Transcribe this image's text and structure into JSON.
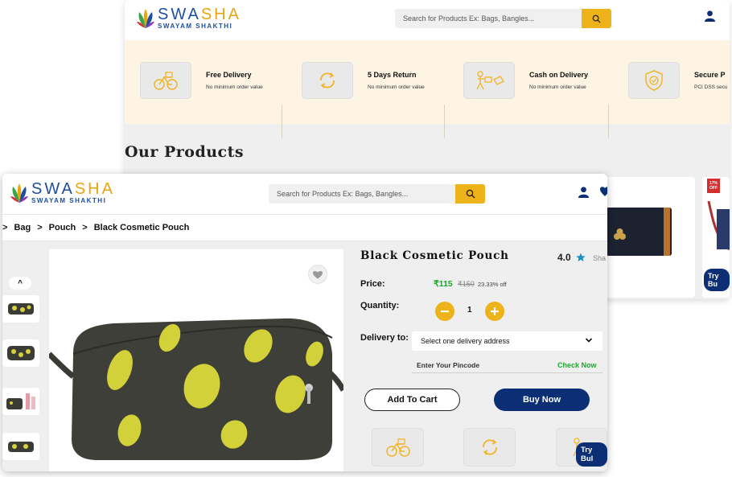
{
  "brand": {
    "name_part1": "SWA",
    "name_part2": "SHA",
    "tagline": "SWAYAM SHAKTHI"
  },
  "search": {
    "placeholder": "Search for Products Ex: Bags, Bangles..."
  },
  "features": [
    {
      "title": "Free Delivery",
      "subtitle": "No minimum order value",
      "icon": "bicycle-delivery-icon"
    },
    {
      "title": "5 Days Return",
      "subtitle": "No minimum order value",
      "icon": "return-arrows-icon"
    },
    {
      "title": "Cash on Delivery",
      "subtitle": "No minimum order value",
      "icon": "cash-delivery-icon"
    },
    {
      "title": "Secure P",
      "subtitle": "PCI DSS secu",
      "icon": "shield-check-icon"
    }
  ],
  "products_section": {
    "title": "Our Products"
  },
  "back_cards": {
    "discount_badge": "17% OFF",
    "try_bulk": "Try Bu"
  },
  "breadcrumb": {
    "items": [
      "Bag",
      "Pouch",
      "Black Cosmetic Pouch"
    ],
    "separator": ">"
  },
  "product": {
    "name": "Black Cosmetic Pouch",
    "rating": "4.0",
    "share": "Sha",
    "price_label": "Price:",
    "price": "₹115",
    "original_price": "₹150",
    "discount": "23.33% off",
    "quantity_label": "Quantity:",
    "quantity": "1",
    "delivery_label": "Delivery to:",
    "delivery_select": "Select one delivery address",
    "pincode_placeholder": "Enter Your Pincode",
    "check_now": "Check Now",
    "add_to_cart": "Add To Cart",
    "buy_now": "Buy Now",
    "try_bulk": "Try Bul"
  },
  "thumb_nav": {
    "up": "^"
  },
  "colors": {
    "brand_blue": "#1d4fa0",
    "accent_yellow": "#eeb21a",
    "navy": "#0b2e74",
    "price_green": "#1ea82e",
    "feature_bg": "#fdf4e3"
  }
}
